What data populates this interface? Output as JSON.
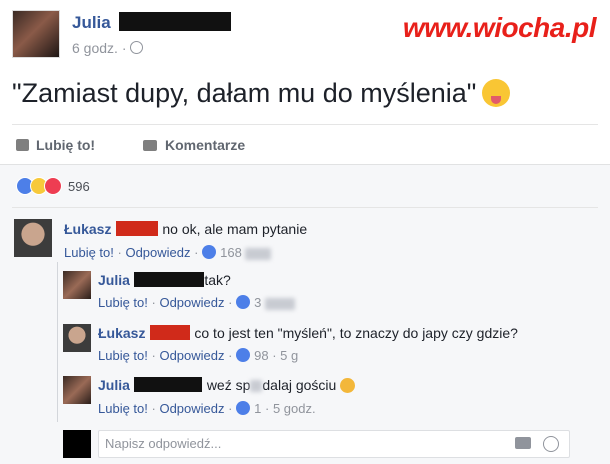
{
  "post": {
    "author": "Julia",
    "time": "6 godz. ·",
    "text": "\"Zamiast dupy, dałam mu do myślenia\"",
    "like_label": "Lubię to!",
    "comment_label": "Komentarze"
  },
  "watermark": "www.wiocha.pl",
  "reactions": {
    "count": "596"
  },
  "comments": [
    {
      "author": "Łukasz",
      "text": "no ok, ale mam pytanie",
      "like": "Lubię to!",
      "reply": "Odpowiedz",
      "likes": "168"
    },
    {
      "author": "Julia",
      "text": "tak?",
      "like": "Lubię to!",
      "reply": "Odpowiedz",
      "likes": "3"
    },
    {
      "author": "Łukasz",
      "text": "co to jest ten \"myśleń\", to znaczy do japy czy gdzie?",
      "like": "Lubię to!",
      "reply": "Odpowiedz",
      "likes": "98",
      "time": "5 g"
    },
    {
      "author": "Julia",
      "text_a": "weź sp",
      "text_b": "dalaj gościu",
      "like": "Lubię to!",
      "reply": "Odpowiedz",
      "likes": "1",
      "time": "5 godz."
    }
  ],
  "reply_box": {
    "placeholder": "Napisz odpowiedź..."
  },
  "separator": "·",
  "icons": {
    "like": "thumbs-up-icon",
    "comment": "comment-icon",
    "camera": "camera-icon",
    "emoji": "emoji-icon",
    "globe": "globe-icon"
  },
  "colors": {
    "name_blue": "#365899",
    "watermark_red": "#e8201a",
    "bg_comments": "#f6f7f9"
  }
}
